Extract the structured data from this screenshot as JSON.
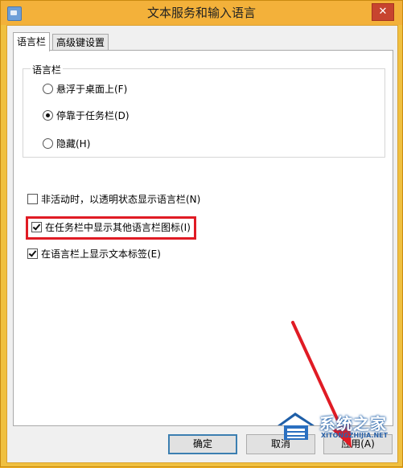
{
  "window": {
    "title": "文本服务和输入语言",
    "close_symbol": "✕"
  },
  "tabs": [
    {
      "label": "语言栏",
      "active": true
    },
    {
      "label": "高级键设置",
      "active": false
    }
  ],
  "language_bar_group": {
    "label": "语言栏",
    "options": [
      {
        "label": "悬浮于桌面上(F)",
        "checked": false
      },
      {
        "label": "停靠于任务栏(D)",
        "checked": true
      },
      {
        "label": "隐藏(H)",
        "checked": false
      }
    ]
  },
  "checkboxes": [
    {
      "label": "非活动时，以透明状态显示语言栏(N)",
      "checked": false
    },
    {
      "label": "在任务栏中显示其他语言栏图标(I)",
      "checked": true
    },
    {
      "label": "在语言栏上显示文本标签(E)",
      "checked": true
    }
  ],
  "buttons": {
    "ok": "确定",
    "cancel": "取消",
    "apply": "应用(A)"
  },
  "watermark": {
    "text": "系统之家",
    "sub": "XITONGZHIJIA.NET"
  },
  "colors": {
    "frame": "#f3b13a",
    "highlight": "#e01b24",
    "arrow": "#e01b24",
    "watermark_blue": "#1f5fa8"
  }
}
